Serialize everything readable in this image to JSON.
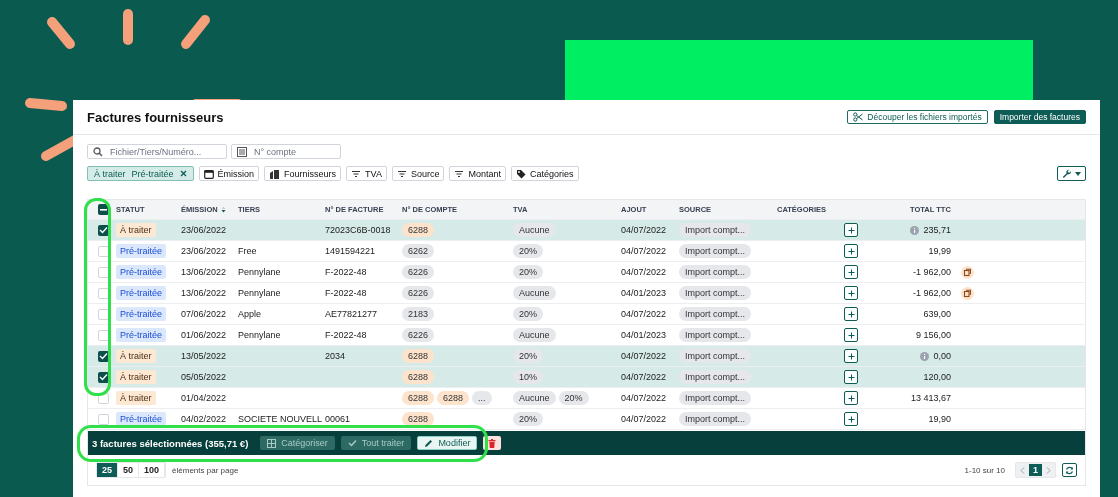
{
  "page": {
    "title": "Factures fournisseurs",
    "header_buttons": [
      {
        "label": "Découper les fichiers importés",
        "kind": "outline"
      },
      {
        "label": "Importer des factures",
        "kind": "primary"
      }
    ]
  },
  "search": {
    "placeholder": "Fichier/Tiers/Numéro..."
  },
  "account_field": {
    "placeholder": "N° compte"
  },
  "filters": [
    {
      "kind": "status",
      "labels": [
        "À traiter",
        "Pré-traitée"
      ]
    },
    {
      "kind": "date",
      "label": "Émission"
    },
    {
      "kind": "supplier",
      "label": "Fournisseurs"
    },
    {
      "kind": "list",
      "label": "TVA"
    },
    {
      "kind": "list",
      "label": "Source"
    },
    {
      "kind": "list",
      "label": "Montant"
    },
    {
      "kind": "tag",
      "label": "Catégories"
    }
  ],
  "table": {
    "select_all": {
      "indeterminate": true
    },
    "columns": [
      {
        "label": "STATUT",
        "sorted": false
      },
      {
        "label": "ÉMISSION",
        "sorted": true
      },
      {
        "label": "TIERS",
        "sorted": false
      },
      {
        "label": "N° DE FACTURE",
        "sorted": false
      },
      {
        "label": "N° DE COMPTE",
        "sorted": false
      },
      {
        "label": "TVA",
        "sorted": false
      },
      {
        "label": "AJOUT",
        "sorted": false
      },
      {
        "label": "SOURCE",
        "sorted": false
      },
      {
        "label": "CATÉGORIES",
        "sorted": false
      },
      {
        "label": "TOTAL TTC",
        "sorted": false
      }
    ],
    "rows": [
      {
        "selected": true,
        "status": {
          "label": "À traiter",
          "kind": "todo"
        },
        "date": "23/06/2022",
        "invoice_no": "72023C6B-0018",
        "accounts": [
          {
            "label": "6288",
            "color": "#fde3cc"
          }
        ],
        "vat": [
          "Aucune"
        ],
        "added": "04/07/2022",
        "source": "Import compt...",
        "total": "235,71",
        "info": true,
        "duplicate": false
      },
      {
        "selected": false,
        "status": {
          "label": "Pré-traitée",
          "kind": "pre"
        },
        "date": "23/06/2022",
        "supplier": "Free",
        "invoice_no": "1491594221",
        "accounts": [
          {
            "label": "6262",
            "color": "#e5e7eb"
          }
        ],
        "vat": [
          "20%"
        ],
        "added": "04/07/2022",
        "source": "Import compt...",
        "total": "19,99",
        "info": false,
        "duplicate": false
      },
      {
        "selected": false,
        "status": {
          "label": "Pré-traitée",
          "kind": "pre"
        },
        "date": "13/06/2022",
        "supplier": "Pennylane",
        "invoice_no": "F-2022-48",
        "accounts": [
          {
            "label": "6226",
            "color": "#e5e7eb"
          }
        ],
        "vat": [
          "20%"
        ],
        "added": "04/07/2022",
        "source": "Import compt...",
        "total": "-1 962,00",
        "info": false,
        "duplicate": true
      },
      {
        "selected": false,
        "status": {
          "label": "Pré-traitée",
          "kind": "pre"
        },
        "date": "13/06/2022",
        "supplier": "Pennylane",
        "invoice_no": "F-2022-48",
        "accounts": [
          {
            "label": "6226",
            "color": "#e5e7eb"
          }
        ],
        "vat": [
          "Aucune"
        ],
        "added": "04/01/2023",
        "source": "Import compt...",
        "total": "-1 962,00",
        "info": false,
        "duplicate": true
      },
      {
        "selected": false,
        "status": {
          "label": "Pré-traitée",
          "kind": "pre"
        },
        "date": "07/06/2022",
        "supplier": "Apple",
        "invoice_no": "AE77821277",
        "accounts": [
          {
            "label": "2183",
            "color": "#e5e7eb"
          }
        ],
        "vat": [
          "20%"
        ],
        "added": "04/07/2022",
        "source": "Import compt...",
        "total": "639,00",
        "info": false,
        "duplicate": false
      },
      {
        "selected": false,
        "status": {
          "label": "Pré-traitée",
          "kind": "pre"
        },
        "date": "01/06/2022",
        "supplier": "Pennylane",
        "invoice_no": "F-2022-48",
        "accounts": [
          {
            "label": "6226",
            "color": "#e5e7eb"
          }
        ],
        "vat": [
          "Aucune"
        ],
        "added": "04/01/2023",
        "source": "Import compt...",
        "total": "9 156,00",
        "info": false,
        "duplicate": false
      },
      {
        "selected": true,
        "status": {
          "label": "À traiter",
          "kind": "todo"
        },
        "date": "13/05/2022",
        "invoice_no": "2034",
        "accounts": [
          {
            "label": "6288",
            "color": "#fde3cc"
          }
        ],
        "vat": [
          "20%"
        ],
        "added": "04/07/2022",
        "source": "Import compt...",
        "total": "0,00",
        "info": true,
        "duplicate": false
      },
      {
        "selected": true,
        "status": {
          "label": "À traiter",
          "kind": "todo"
        },
        "date": "05/05/2022",
        "accounts": [
          {
            "label": "6288",
            "color": "#fde3cc"
          }
        ],
        "vat": [
          "10%"
        ],
        "added": "04/07/2022",
        "source": "Import compt...",
        "total": "120,00",
        "info": false,
        "duplicate": false
      },
      {
        "selected": false,
        "status": {
          "label": "À traiter",
          "kind": "todo"
        },
        "date": "01/04/2022",
        "accounts": [
          {
            "label": "6288",
            "color": "#fde3cc"
          },
          {
            "label": "6288",
            "color": "#fde3cc"
          },
          {
            "label": "...",
            "color": "#e5e7eb"
          }
        ],
        "vat": [
          "Aucune",
          "20%"
        ],
        "added": "04/07/2022",
        "source": "Import compt...",
        "total": "13 413,67",
        "info": false,
        "duplicate": false
      },
      {
        "selected": false,
        "status": {
          "label": "Pré-traitée",
          "kind": "pre"
        },
        "date": "04/02/2022",
        "supplier": "SOCIETE NOUVELL",
        "invoice_no": "00061",
        "accounts": [
          {
            "label": "6288",
            "color": "#fde3cc"
          }
        ],
        "vat": [
          "20%"
        ],
        "added": "04/07/2022",
        "source": "Import compt...",
        "total": "19,90",
        "info": false,
        "duplicate": false
      }
    ]
  },
  "selection_bar": {
    "summary": "3 factures sélectionnées (355,71 €)",
    "actions": [
      {
        "kind": "categorize",
        "label": "Catégoriser",
        "disabled": true
      },
      {
        "kind": "process",
        "label": "Tout traiter",
        "disabled": true
      },
      {
        "kind": "edit",
        "label": "Modifier",
        "disabled": false
      },
      {
        "kind": "delete",
        "disabled": false
      }
    ]
  },
  "pagination": {
    "sizes": [
      {
        "label": "25",
        "selected": true
      },
      {
        "label": "50",
        "selected": false
      },
      {
        "label": "100",
        "selected": false
      }
    ],
    "sizes_label": "éléments par page",
    "range": "1-10 sur 10",
    "pages": [
      {
        "label": "1",
        "selected": true
      }
    ]
  }
}
